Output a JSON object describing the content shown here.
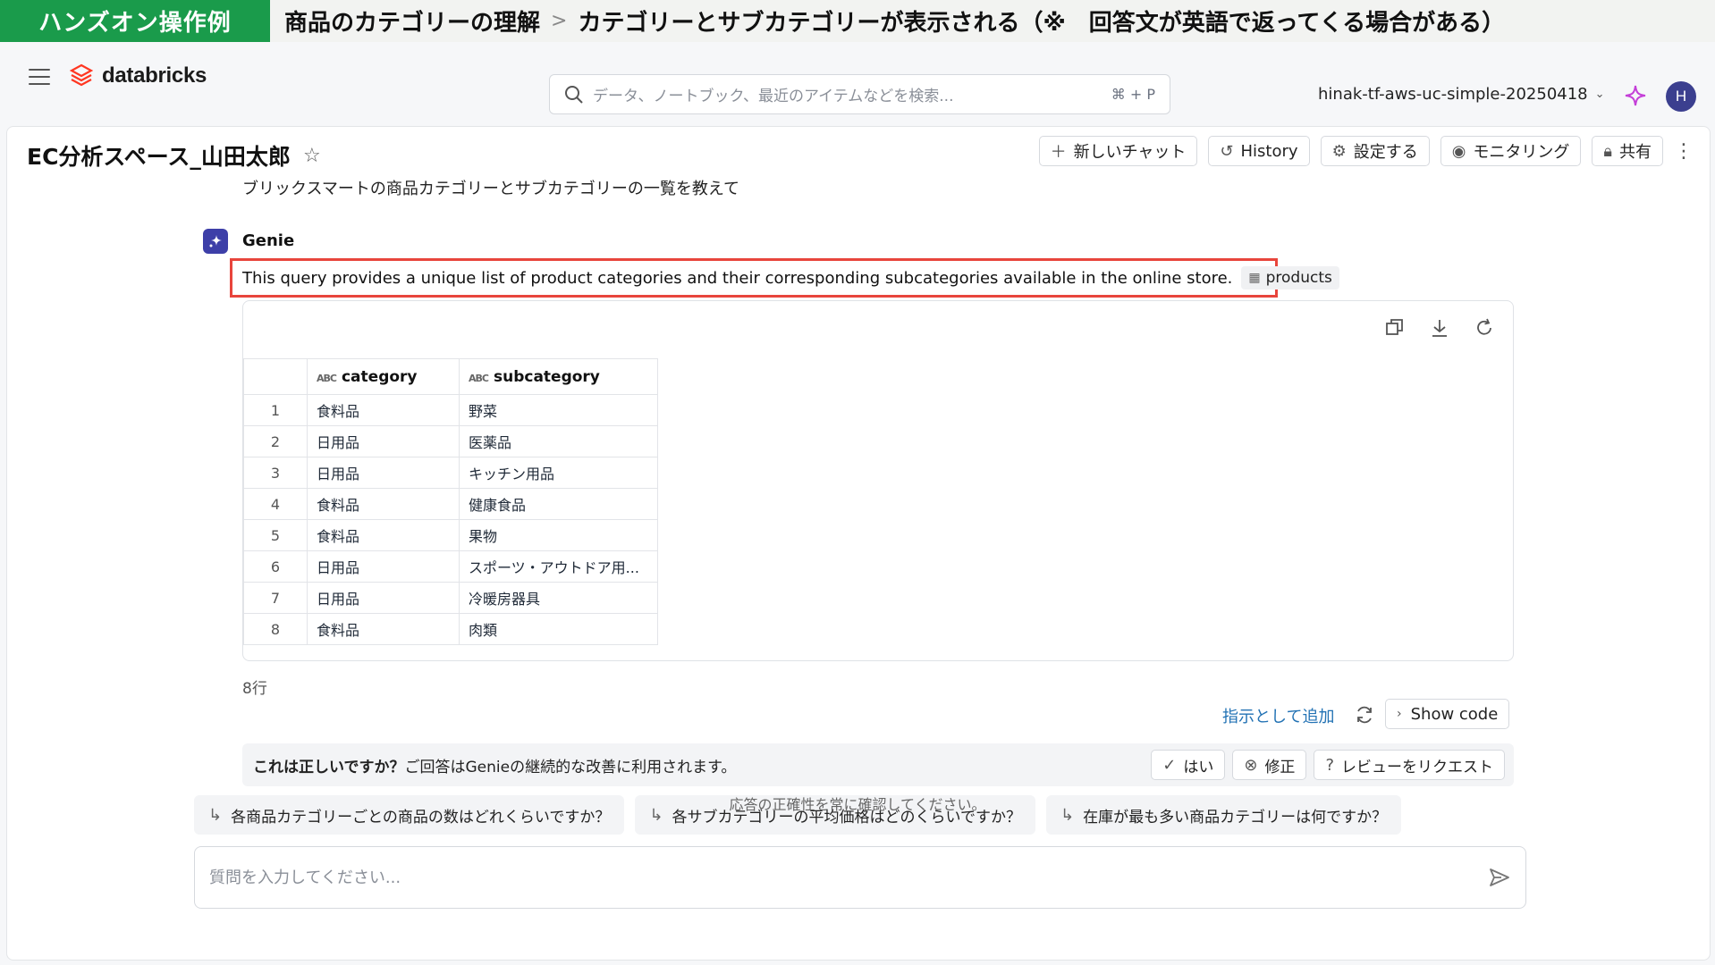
{
  "banner": {
    "tag": "ハンズオン操作例",
    "crumb1": "商品のカテゴリーの理解",
    "separator": ">",
    "crumb2": "カテゴリーとサブカテゴリーが表示される（※　回答文が英語で返ってくる場合がある）"
  },
  "topbar": {
    "logo_text": "databricks",
    "search_placeholder": "データ、ノートブック、最近のアイテムなどを検索...",
    "search_shortcut": "⌘ + P",
    "workspace": "hinak-tf-aws-uc-simple-20250418",
    "avatar_initial": "H"
  },
  "space": {
    "title": "EC分析スペース_山田太郎",
    "actions": {
      "new_chat": "新しいチャット",
      "history": "History",
      "settings": "設定する",
      "monitoring": "モニタリング",
      "share": "共有"
    }
  },
  "chat": {
    "question": "ブリックスマートの商品カテゴリーとサブカテゴリーの一覧を教えて",
    "assistant_name": "Genie",
    "summary": "This query provides a unique list of product categories and their corresponding subcategories available in the online store.",
    "table_chip": "products",
    "columns": [
      "category",
      "subcategory"
    ],
    "rows": [
      [
        "1",
        "食料品",
        "野菜"
      ],
      [
        "2",
        "日用品",
        "医薬品"
      ],
      [
        "3",
        "日用品",
        "キッチン用品"
      ],
      [
        "4",
        "食料品",
        "健康食品"
      ],
      [
        "5",
        "食料品",
        "果物"
      ],
      [
        "6",
        "日用品",
        "スポーツ・アウトドア用..."
      ],
      [
        "7",
        "日用品",
        "冷暖房器具"
      ],
      [
        "8",
        "食料品",
        "肉類"
      ]
    ],
    "row_count": "8行",
    "add_instruction": "指示として追加",
    "show_code": "Show code",
    "feedback_question": "これは正しいですか？",
    "feedback_note": "ご回答はGenieの継続的な改善に利用されます。",
    "feedback_yes": "はい",
    "feedback_fix": "修正",
    "feedback_review": "レビューをリクエスト",
    "suggestions": [
      "各商品カテゴリーごとの商品の数はどれくらいですか？",
      "各サブカテゴリーの平均価格はどのくらいですか？",
      "在庫が最も多い商品カテゴリーは何ですか？"
    ],
    "input_placeholder": "質問を入力してください...",
    "disclaimer": "応答の正確性を常に確認してください。"
  },
  "colors": {
    "banner_green": "#1a9b4b",
    "highlight_red": "#e8453c",
    "genie_icon": "#3d3fa8",
    "link_blue": "#2272b4"
  }
}
